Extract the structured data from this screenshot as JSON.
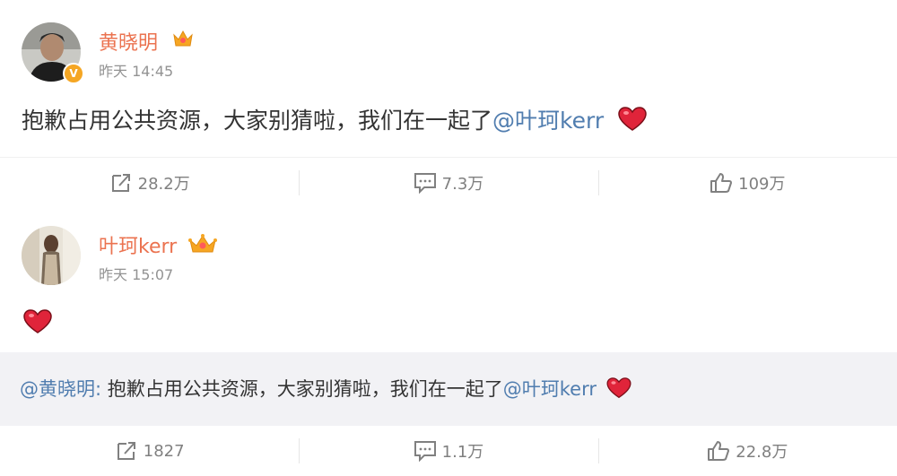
{
  "post1": {
    "username": "黄晓明",
    "time": "昨天 14:45",
    "text": "抱歉占用公共资源，大家别猜啦，我们在一起了",
    "mention": "@叶珂kerr",
    "avatar_badge": "V",
    "actions": {
      "repost": "28.2万",
      "comment": "7.3万",
      "like": "109万"
    }
  },
  "post2": {
    "username": "叶珂kerr",
    "time": "昨天 15:07",
    "quote": {
      "mention": "@黄晓明",
      "separator": ": ",
      "text": "抱歉占用公共资源，大家别猜啦，我们在一起了",
      "mention2": "@叶珂kerr"
    },
    "actions": {
      "repost": "1827",
      "comment": "1.1万",
      "like": "22.8万"
    }
  },
  "colors": {
    "username": "#eb7350",
    "mention": "#507daf",
    "heart": "#e0243a",
    "quote_bg": "#f2f2f5"
  }
}
